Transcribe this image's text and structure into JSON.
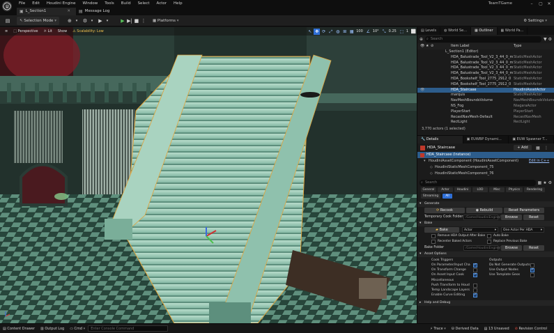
{
  "app": {
    "window_title": "TeamTGame"
  },
  "menu": [
    "File",
    "Edit",
    "Houdini Engine",
    "Window",
    "Tools",
    "Build",
    "Select",
    "Actor",
    "Help"
  ],
  "doc_tabs": [
    {
      "label": "L_Section1",
      "active": true
    },
    {
      "label": "Message Log",
      "active": false
    }
  ],
  "toolbar": {
    "selection_mode": "Selection Mode",
    "platforms": "Platforms",
    "settings": "Settings"
  },
  "viewport": {
    "perspective": "Perspective",
    "lit": "Lit",
    "show": "Show",
    "scalability": "Scalability: Low",
    "grid_size": "100",
    "rotation_snap": "10°",
    "scale_snap": "0.25",
    "camera_speed": "1"
  },
  "outliner": {
    "tabs": [
      "Levels",
      "World Se...",
      "Outliner",
      "World Pa..."
    ],
    "search_placeholder": "Search",
    "col_label": "Item Label",
    "col_type": "Type",
    "rows": [
      {
        "label": "L_Section1 (Editor)",
        "type": "",
        "selected": false
      },
      {
        "label": "HDA_Balustrade_Tool_V2_3_44_0_m",
        "type": "StaticMeshActor",
        "selected": false
      },
      {
        "label": "HDA_Balustrade_Tool_V2_3_44_0_m",
        "type": "StaticMeshActor",
        "selected": false
      },
      {
        "label": "HDA_Balustrade_Tool_V2_3_44_0_m",
        "type": "StaticMeshActor",
        "selected": false
      },
      {
        "label": "HDA_Balustrade_Tool_V2_3_44_0_m",
        "type": "StaticMeshActor",
        "selected": false
      },
      {
        "label": "HDA_Bookshelf_Tool_2775_2912_0",
        "type": "StaticMeshActor",
        "selected": false
      },
      {
        "label": "HDA_Bookshelf_Tool_2775_2912_0",
        "type": "StaticMeshActor",
        "selected": false
      },
      {
        "label": "HDA_Staircase",
        "type": "HoudiniAssetActor",
        "selected": true
      },
      {
        "label": "marquis",
        "type": "StaticMeshActor",
        "selected": false
      },
      {
        "label": "NavMeshBoundsVolume",
        "type": "NavMeshBoundsVolume",
        "selected": false
      },
      {
        "label": "NS_Fog",
        "type": "NiagaraActor",
        "selected": false
      },
      {
        "label": "PlayerStart",
        "type": "PlayerStart",
        "selected": false
      },
      {
        "label": "RecastNavMesh-Default",
        "type": "RecastNavMesh",
        "selected": false
      },
      {
        "label": "RectLight",
        "type": "RectLight",
        "selected": false
      }
    ],
    "footer": "3,770 actors (1 selected)"
  },
  "details": {
    "tabs": [
      "Details",
      "EUWBP Dynami...",
      "EUW Spawner T..."
    ],
    "actor_name": "HDA_Staircase",
    "add_label": "+ Add",
    "tree": [
      "HDA_Staircase (Instance)",
      "HoudiniAssetComponent (HoudiniAssetComponent)",
      "HoudiniStaticMeshComponent_75",
      "HoudiniStaticMeshComponent_76"
    ],
    "edit_cpp": "Edit in C++",
    "search_placeholder": "Search",
    "filters": [
      "General",
      "Actor",
      "Houdini",
      "LOD",
      "Misc",
      "Physics",
      "Rendering",
      "Streaming",
      "All"
    ],
    "sec_generate": "Generate",
    "recook": "Recook",
    "rebuild": "Rebuild",
    "reset_params": "Reset Parameters",
    "temp_cook_folder": "Temporary Cook Folder",
    "temp_cook_placeholder": "/Game/HoudiniEngine/Temp",
    "browse": "Browse",
    "reset": "Reset",
    "sec_bake": "Bake",
    "bake": "Bake",
    "bake_type": "Actor",
    "bake_option": "One Actor Per HDA",
    "remove_hda": "Remove HDA Output After Bake",
    "auto_bake": "Auto Bake",
    "recenter": "Recenter Baked Actors",
    "replace_prev": "Replace Previous Bake",
    "bake_folder": "Bake Folder",
    "bake_folder_placeholder": "/Game/HoudiniEngine/Bake",
    "sec_asset_options": "Asset Options",
    "cook_triggers": "Cook Triggers",
    "on_param_change": "On Parameter/Input Cha",
    "on_transform": "On Transform Change",
    "on_asset_input": "On Asset Input Cook",
    "misc": "Miscellaneous",
    "push_transform": "Push Transform to Houd",
    "temp_landscape": "Temp Landscape Layers",
    "enable_curve": "Enable Curve Editing",
    "outputs": "Outputs",
    "no_gen_outputs": "Do Not Generate Outputs",
    "use_output_nodes": "Use Output Nodes",
    "use_template_geos": "Use Template Geos",
    "sec_help": "Help and Debug"
  },
  "statusbar": {
    "content_drawer": "Content Drawer",
    "output_log": "Output Log",
    "cmd": "Cmd",
    "cmd_placeholder": "Enter Console Command",
    "trace": "Trace",
    "derived_data": "Derived Data",
    "unsaved": "13 Unsaved",
    "revision_control": "Revision Control"
  }
}
